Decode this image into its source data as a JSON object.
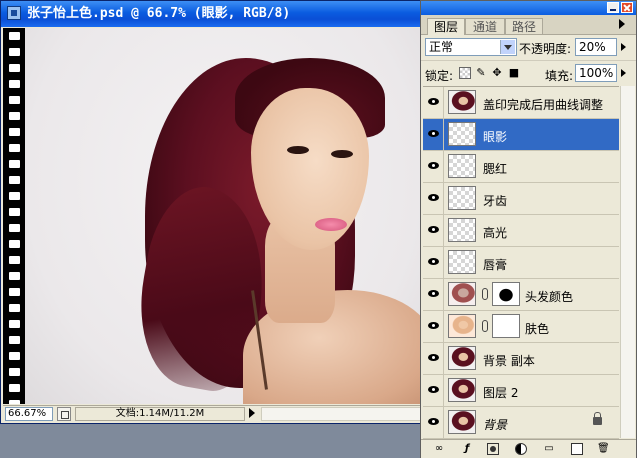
{
  "document": {
    "title": "张子怡上色.psd @ 66.7% (眼影, RGB/8)",
    "zoom": "66.67%",
    "doc_info": "文档:1.14M/11.2M"
  },
  "layers_panel": {
    "tabs": [
      {
        "label": "图层",
        "active": true
      },
      {
        "label": "通道",
        "active": false
      },
      {
        "label": "路径",
        "active": false
      }
    ],
    "blend_mode": "正常",
    "opacity_label": "不透明度:",
    "opacity_value": "20%",
    "lock_label": "锁定:",
    "fill_label": "填充:",
    "fill_value": "100%",
    "layers": [
      {
        "name": "盖印完成后用曲线调整",
        "thumb": "photo",
        "visible": true,
        "selected": false
      },
      {
        "name": "眼影",
        "thumb": "transparent",
        "visible": true,
        "selected": true
      },
      {
        "name": "腮红",
        "thumb": "transparent",
        "visible": true,
        "selected": false
      },
      {
        "name": "牙齿",
        "thumb": "transparent",
        "visible": true,
        "selected": false
      },
      {
        "name": "高光",
        "thumb": "transparent",
        "visible": true,
        "selected": false
      },
      {
        "name": "唇膏",
        "thumb": "transparent",
        "visible": true,
        "selected": false
      },
      {
        "name": "头发颜色",
        "thumb": "hair",
        "mask": "hair",
        "visible": true,
        "selected": false
      },
      {
        "name": "肤色",
        "thumb": "tinted",
        "mask": "skin",
        "visible": true,
        "selected": false
      },
      {
        "name": "背景 副本",
        "thumb": "photo",
        "visible": true,
        "selected": false
      },
      {
        "name": "图层 2",
        "thumb": "photo",
        "visible": true,
        "selected": false
      },
      {
        "name": "背景",
        "thumb": "photo",
        "visible": true,
        "selected": false,
        "locked": true,
        "italic": true
      }
    ],
    "toolbar_icons": [
      "link-layers-icon",
      "layer-style-icon",
      "add-mask-icon",
      "adjustment-layer-icon",
      "new-group-icon",
      "new-layer-icon",
      "delete-layer-icon"
    ]
  }
}
